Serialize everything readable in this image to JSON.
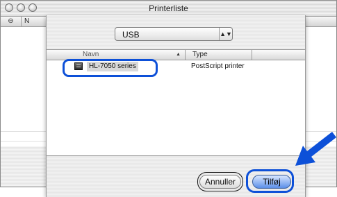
{
  "window": {
    "title": "Printerliste",
    "column_header_first": "⊖",
    "column_header_second": "N"
  },
  "dialog": {
    "connection_popup": {
      "selected": "USB",
      "arrows": "▲▼"
    },
    "table": {
      "columns": {
        "name": "Navn",
        "type": "Type"
      },
      "sort_indicator": "▲",
      "rows": [
        {
          "name": "HL-7050 series",
          "type": "PostScript printer"
        }
      ]
    },
    "buttons": {
      "cancel": "Annuller",
      "add": "Tilføj"
    }
  },
  "colors": {
    "highlight": "#0d50d8",
    "default_button": "#5b8fe8",
    "pointer_arrow": "#0d50d8"
  },
  "icons": {
    "printer": "printer-icon",
    "popup_arrows": "popup-arrows-icon",
    "pointer": "pointer-arrow-icon"
  }
}
